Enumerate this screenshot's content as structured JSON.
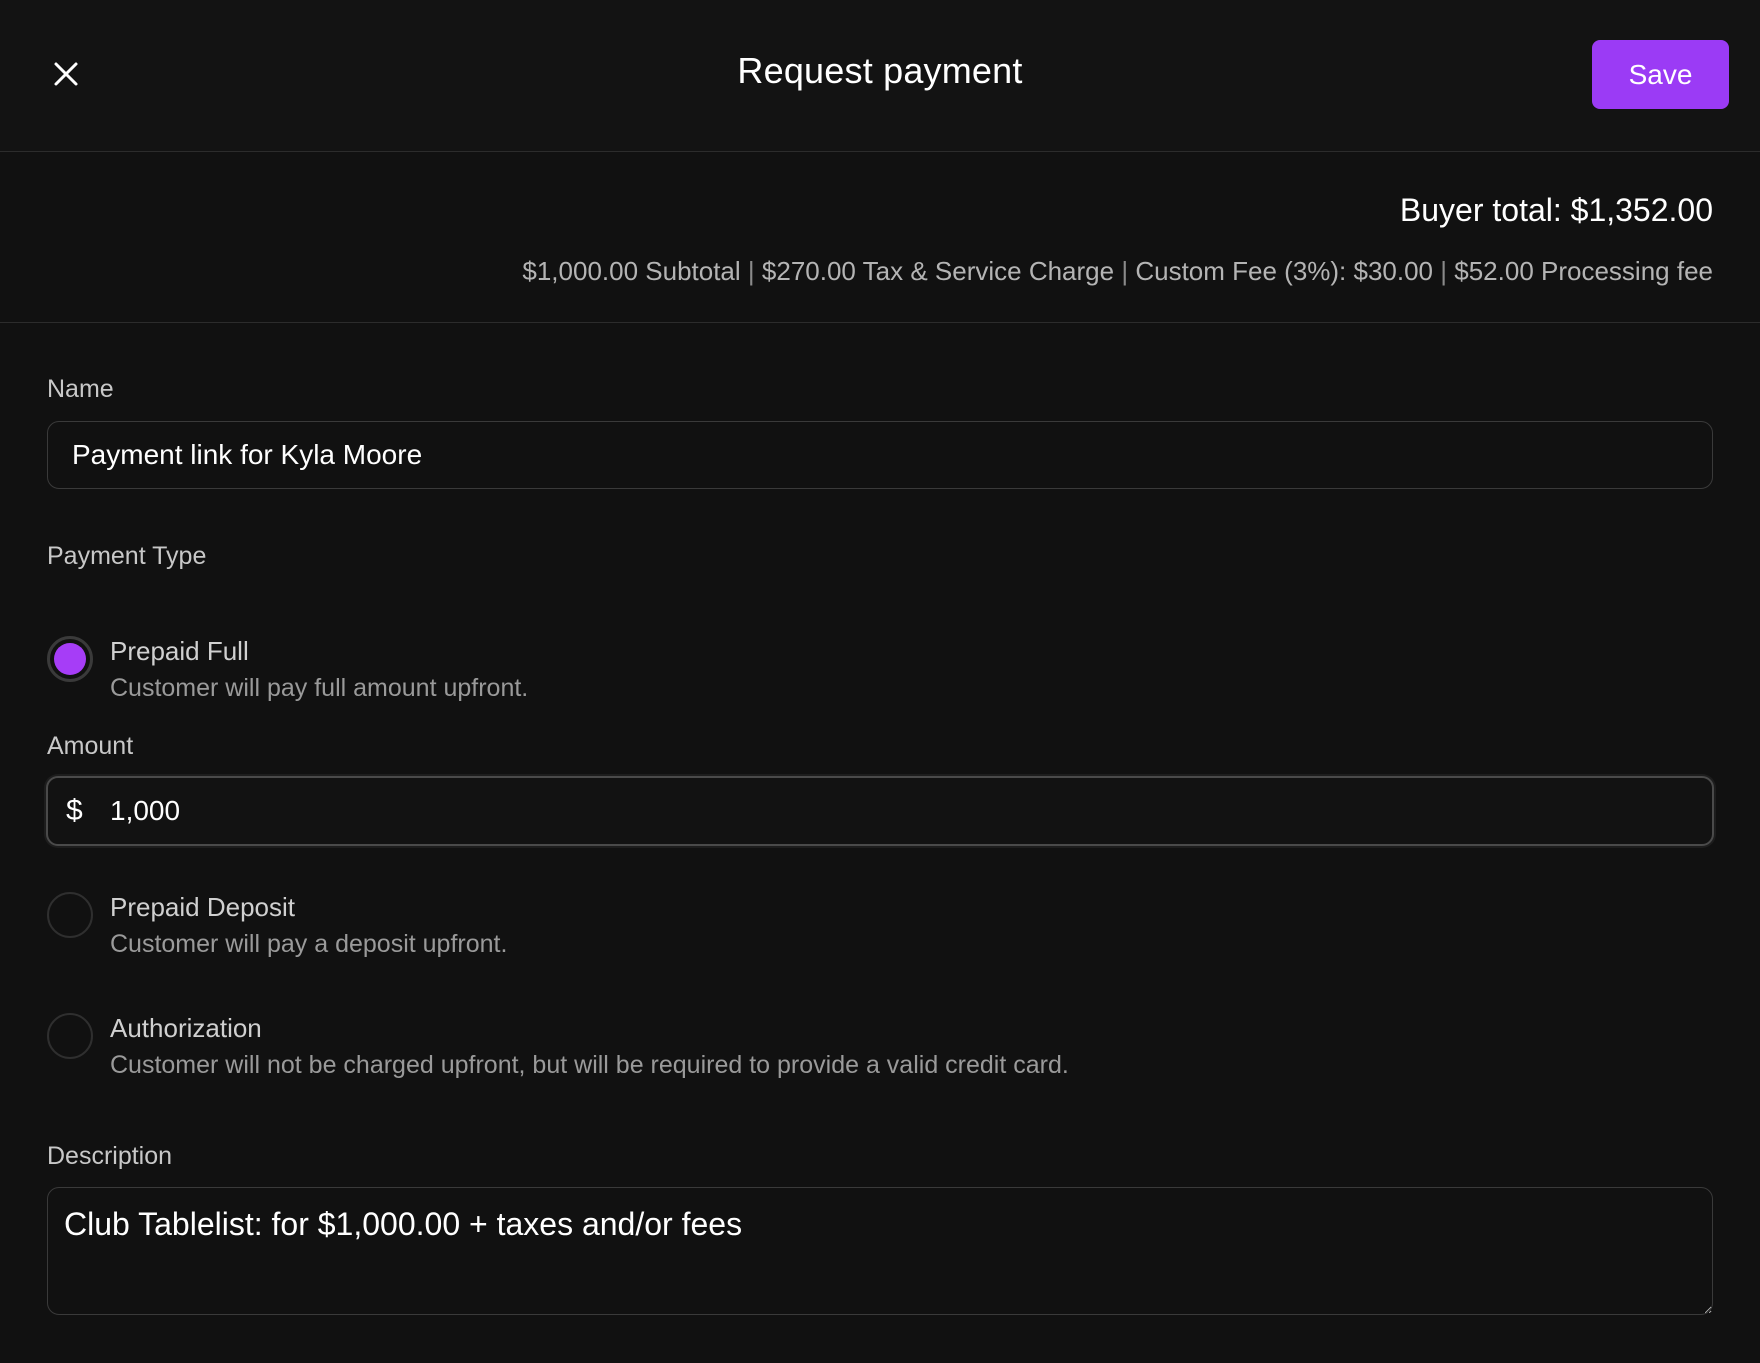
{
  "header": {
    "title": "Request payment",
    "save_label": "Save",
    "close_icon": "close-icon",
    "accent_color": "#9b3bf5"
  },
  "summary": {
    "buyer_total": "Buyer total: $1,352.00",
    "subtotal": "$1,000.00 Subtotal",
    "tax": "$270.00 Tax & Service Charge",
    "custom_fee": "Custom Fee (3%): $30.00",
    "processing_fee": "$52.00 Processing fee",
    "separator": "|"
  },
  "form": {
    "name_label": "Name",
    "name_value": "Payment link for Kyla Moore",
    "payment_type_label": "Payment Type",
    "options": [
      {
        "title": "Prepaid Full",
        "description": "Customer will pay full amount upfront.",
        "selected": true
      },
      {
        "title": "Prepaid Deposit",
        "description": "Customer will pay a deposit upfront.",
        "selected": false
      },
      {
        "title": "Authorization",
        "description": "Customer will not be charged upfront, but will be required to provide a valid credit card.",
        "selected": false
      }
    ],
    "amount_label": "Amount",
    "currency_symbol": "$",
    "amount_value": "1,000",
    "description_label": "Description",
    "description_value": "Club Tablelist: for $1,000.00 + taxes and/or fees"
  }
}
